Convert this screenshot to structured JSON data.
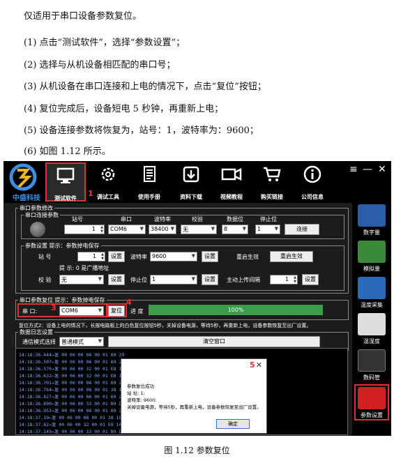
{
  "document": {
    "intro": "仅适用于串口设备参数复位。",
    "steps": [
      "(1)  点击“测试软件”，选择“参数设置”；",
      "(2)  选择与从机设备相匹配的串口号；",
      "(3)  从机设备在串口连接和上电的情况下，点击“复位”按钮；",
      "(4)  复位完成后，设备短电 5 秒钟，再重新上电；",
      "(5)  设备连接参数将恢复为，站号：1，波特率为：9600；",
      "(6)  如图 1.12 所示。"
    ],
    "caption": "图 1.12  参数复位"
  },
  "app": {
    "logo_text": "中盛科技",
    "nav": [
      {
        "label": "测试软件",
        "icon": "monitor-icon"
      },
      {
        "label": "调试工具",
        "icon": "gear-icon"
      },
      {
        "label": "使用手册",
        "icon": "document-icon"
      },
      {
        "label": "资料下载",
        "icon": "download-icon"
      },
      {
        "label": "视频教程",
        "icon": "video-icon"
      },
      {
        "label": "购买链接",
        "icon": "cart-icon"
      },
      {
        "label": "公司信息",
        "icon": "info-icon"
      }
    ],
    "window_controls": {
      "menu": "≡",
      "minimize": "—",
      "close": "✕"
    },
    "sidebar": [
      {
        "label": "数字量",
        "color": "#2a5ea8"
      },
      {
        "label": "模拟量",
        "color": "#3a8a3a"
      },
      {
        "label": "温度采集",
        "color": "#2a6ab8"
      },
      {
        "label": "温湿度",
        "color": "#dddddd"
      },
      {
        "label": "数码管",
        "color": "#333333"
      },
      {
        "label": "参数设置",
        "color": "#d02020"
      }
    ],
    "annotations": {
      "n1": "1",
      "n2": "2",
      "n3": "3",
      "n4": "4",
      "n5": "5"
    },
    "param_modify": {
      "title": "串口参数修改",
      "connect": {
        "title": "串口连接参数",
        "headers": [
          "站号",
          "串口",
          "波特率",
          "校验",
          "数据位",
          "停止位"
        ],
        "station": "1",
        "port": "COM6",
        "baud": "38400",
        "parity": "无",
        "databits": "8",
        "stopbits": "1",
        "connect_btn": "连接"
      },
      "setting": {
        "title": "参数设置 提示：参数掉电保存",
        "station_label": "站  号",
        "station_value": "1",
        "set_btn": "设置",
        "baud_label": "波特率",
        "baud_value": "9600",
        "restart_label": "重启生效",
        "restart_btn": "重启生效",
        "hint": "提  示: 0 是广播地址",
        "parity_label": "校  验",
        "parity_value": "无",
        "stop_label": "停止位",
        "stop_value": "1",
        "upload_label": "主动上传间隔",
        "upload_value": "1"
      }
    },
    "reset": {
      "title": "串口参数复位 提示：参数掉电保存",
      "port_label": "串  口:",
      "port_value": "COM6",
      "reset_btn": "复位",
      "progress_label": "进  度",
      "progress_text": "100%",
      "progress_value": 100,
      "note": "复位方式2：设备上电的情况下，长按电路板上的白色复位按钮5秒，关掉设备电源，等待5秒，再重新上电，设备参数恢复至出厂设置。"
    },
    "log_settings": {
      "title": "数据日志设置",
      "mode_label": "通信模式选择",
      "mode_value": "普通模式",
      "clear_btn": "清空窗口"
    },
    "log_lines": [
      "14:18:36.444→发 00 06 00 0A 00 01 69 29",
      "14:18:36.507←发 00 06 00 0A 00 01 69 29",
      "14:18:36.570→发 00 06 00 32 00 01 E8 14",
      "14:18:36.632←发 00 06 00 32 00 01 E8 14",
      "14:18:36.701→发 00 06 00 0A 00 01 69 29",
      "14:18:36.764←发 00 06 00 08 00 01 38 19",
      "14:18:36.827→发 00 06 00 0A 00 01 69 29",
      "14:18:36.890←发 00 06 00 33 00 01 B9 D4",
      "14:18:36.953→发 00 06 00 0A 00 01 69 29",
      "14:18:37.19←发 00 06 00 08 00 01 38 19",
      "14:18:37.82→发 00 06 00 32 00 01 E8 14",
      "14:18:37.145←发 00 06 00 33 00 01 B9 D4"
    ],
    "dialog": {
      "close": "✕",
      "lines": [
        "参数复位成功",
        "站  址: 1;",
        "波特率: 9600;",
        "关掉设备电源，等待5秒，再重新上电，设备参数恢复至出厂设置。"
      ],
      "ok_btn": "确定"
    }
  }
}
